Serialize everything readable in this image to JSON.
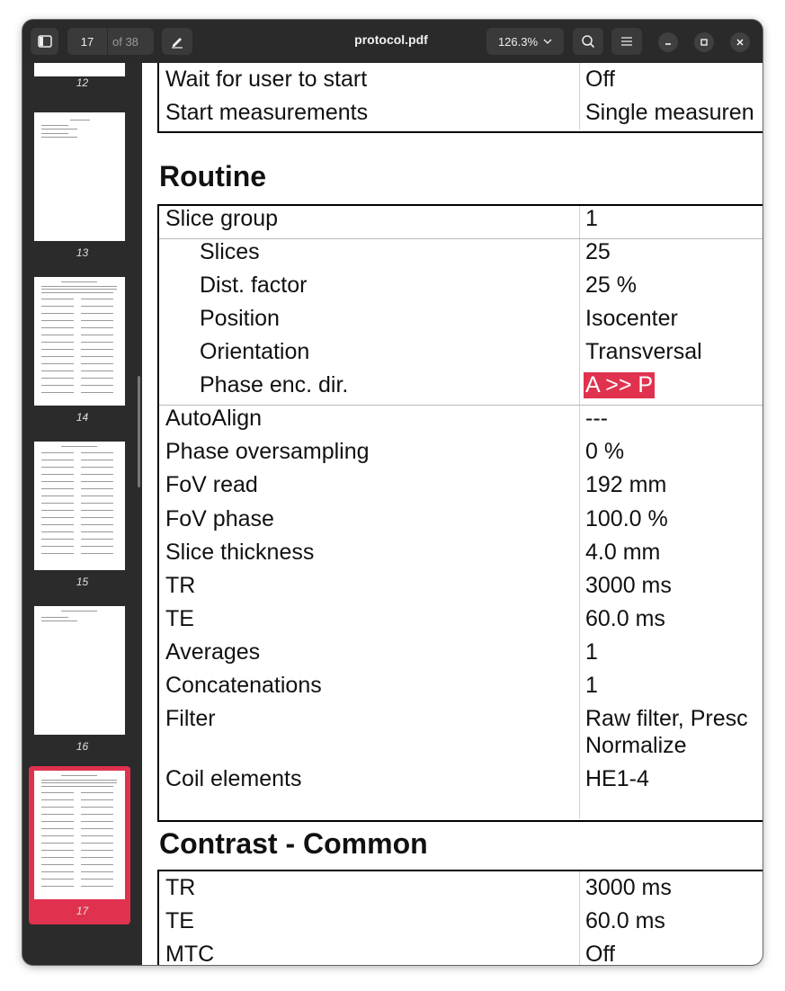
{
  "window": {
    "title": "protocol.pdf",
    "current_page": "17",
    "page_count_label": "of 38",
    "zoom": "126.3%"
  },
  "sidebar": {
    "thumbnails": [
      {
        "label": "12"
      },
      {
        "label": "13"
      },
      {
        "label": "14"
      },
      {
        "label": "15"
      },
      {
        "label": "16"
      },
      {
        "label": "17",
        "selected": true
      }
    ]
  },
  "document": {
    "top_rows": [
      {
        "key": "Wait for user to start",
        "value": "Off"
      },
      {
        "key": "Start measurements",
        "value": "Single measuren"
      }
    ],
    "routine": {
      "heading": "Routine",
      "rows": [
        {
          "key": "Slice group",
          "value": "1"
        },
        {
          "key": "Slices",
          "value": "25"
        },
        {
          "key": "Dist. factor",
          "value": "25 %"
        },
        {
          "key": "Position",
          "value": "Isocenter"
        },
        {
          "key": "Orientation",
          "value": "Transversal"
        },
        {
          "key": "Phase enc. dir.",
          "value": "A >> P"
        },
        {
          "key": "AutoAlign",
          "value": "---"
        },
        {
          "key": "Phase oversampling",
          "value": "0 %"
        },
        {
          "key": "FoV read",
          "value": "192 mm"
        },
        {
          "key": "FoV phase",
          "value": "100.0 %"
        },
        {
          "key": "Slice thickness",
          "value": "4.0 mm"
        },
        {
          "key": "TR",
          "value": "3000 ms"
        },
        {
          "key": "TE",
          "value": "60.0 ms"
        },
        {
          "key": "Averages",
          "value": "1"
        },
        {
          "key": "Concatenations",
          "value": "1"
        },
        {
          "key": "Filter",
          "value": "Raw filter, Presc",
          "value2": "Normalize"
        },
        {
          "key": "Coil elements",
          "value": "HE1-4"
        }
      ]
    },
    "contrast": {
      "heading": "Contrast - Common",
      "rows": [
        {
          "key": "TR",
          "value": "3000 ms"
        },
        {
          "key": "TE",
          "value": "60.0 ms"
        },
        {
          "key": "MTC",
          "value": "Off"
        }
      ]
    }
  },
  "colors": {
    "accent": "#e0324f",
    "titlebar": "#2a2a2a",
    "sidebar": "#2b2b2b"
  }
}
